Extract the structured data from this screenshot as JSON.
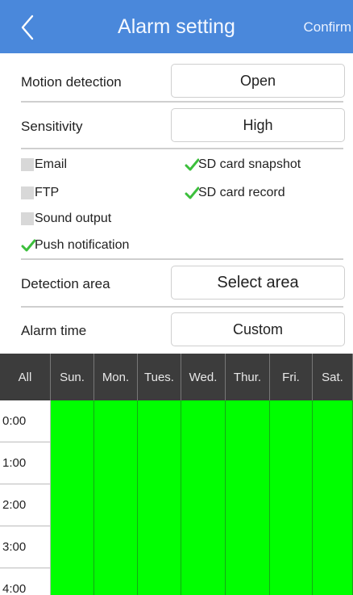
{
  "header": {
    "back_icon": "chevron-left-icon",
    "title": "Alarm setting",
    "confirm_label": "Confirm",
    "color": "#4a88db"
  },
  "settings": {
    "motion_detection": {
      "label": "Motion detection",
      "value": "Open"
    },
    "sensitivity": {
      "label": "Sensitivity",
      "value": "High"
    },
    "detection_area": {
      "label": "Detection area",
      "value": "Select area"
    },
    "alarm_time": {
      "label": "Alarm time",
      "value": "Custom"
    }
  },
  "options": [
    {
      "label": "Email",
      "checked": false
    },
    {
      "label": "SD card snapshot",
      "checked": true
    },
    {
      "label": "FTP",
      "checked": false
    },
    {
      "label": "SD card record",
      "checked": true
    },
    {
      "label": "Sound output",
      "checked": false
    },
    {
      "label": "Push notification",
      "checked": true
    }
  ],
  "schedule": {
    "all_label": "All",
    "days": [
      "Sun.",
      "Mon.",
      "Tues.",
      "Wed.",
      "Thur.",
      "Fri.",
      "Sat."
    ],
    "times": [
      "0:00",
      "1:00",
      "2:00",
      "3:00",
      "4:00"
    ],
    "active_color": "#00ff00",
    "all_active": true
  }
}
